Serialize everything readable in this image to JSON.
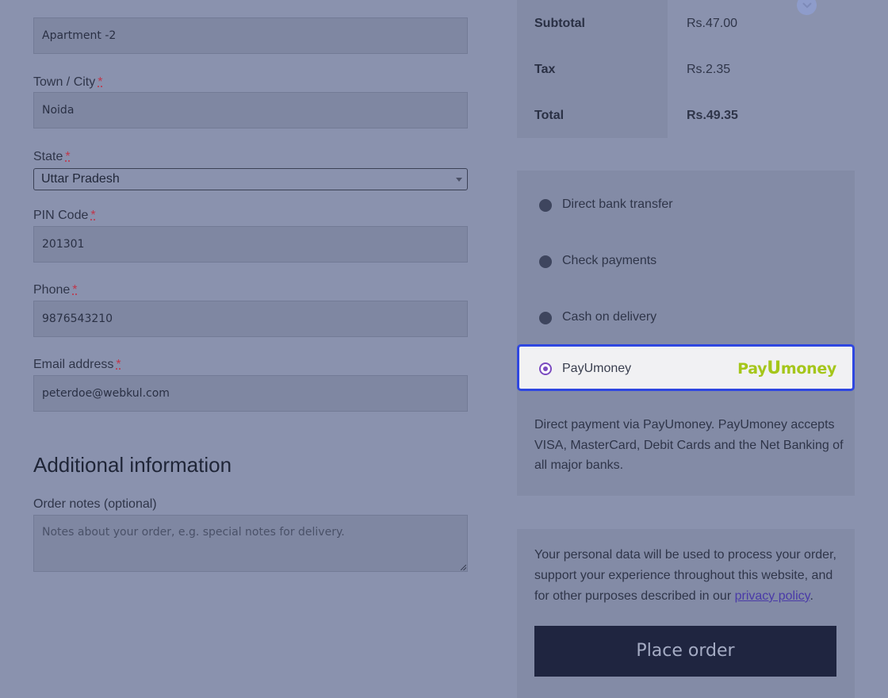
{
  "billing": {
    "apartment_value": "Apartment -2",
    "town_label": "Town / City",
    "town_value": "Noida",
    "state_label": "State",
    "state_value": "Uttar Pradesh",
    "pin_label": "PIN Code",
    "pin_value": "201301",
    "phone_label": "Phone",
    "phone_value": "9876543210",
    "email_label": "Email address",
    "email_value": "peterdoe@webkul.com",
    "required_mark": "*"
  },
  "additional": {
    "heading": "Additional information",
    "notes_label": "Order notes (optional)",
    "notes_placeholder": "Notes about your order, e.g. special notes for delivery."
  },
  "totals": {
    "subtotal_label": "Subtotal",
    "subtotal_value": "Rs.47.00",
    "tax_label": "Tax",
    "tax_value": "Rs.2.35",
    "total_label": "Total",
    "total_value": "Rs.49.35"
  },
  "payment": {
    "methods": [
      {
        "label": "Direct bank transfer"
      },
      {
        "label": "Check payments"
      },
      {
        "label": "Cash on delivery"
      },
      {
        "label": "PayUmoney"
      }
    ],
    "selected": "PayUmoney",
    "logo_text_1": "Pay",
    "logo_text_2": "U",
    "logo_text_3": "money",
    "description": "Direct payment via PayUmoney. PayUmoney accepts VISA, MasterCard, Debit Cards and the Net Banking of all major banks."
  },
  "privacy": {
    "text_before": "Your personal data will be used to process your order, support your experience throughout this website, and for other purposes described in our ",
    "link_text": "privacy policy",
    "text_after": "."
  },
  "place_order_label": "Place order",
  "colors": {
    "accent_border": "#2f47e0",
    "logo_green": "#a5c61a",
    "radio_purple": "#7b4bc0",
    "button_bg": "#1f2540"
  }
}
